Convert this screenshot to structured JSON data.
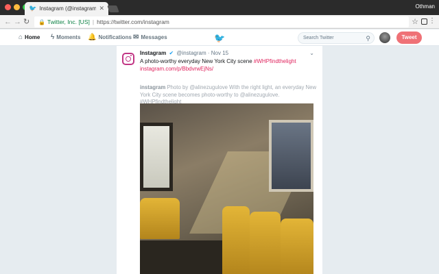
{
  "browser": {
    "tab_title": "Instagram (@instagram) | Twi",
    "profile_name": "Othman",
    "security_label": "Twitter, Inc. [US]",
    "url": "https://twitter.com/instagram"
  },
  "nav": {
    "home": "Home",
    "moments": "Moments",
    "notifications": "Notifications",
    "messages": "Messages",
    "search_placeholder": "Search Twitter",
    "tweet_button": "Tweet"
  },
  "tweet": {
    "author": "Instagram",
    "handle": "@instagram",
    "date": "· Nov 15",
    "text": "A photo-worthy everyday New York City scene",
    "hashtag": "#WHPfindthelight",
    "link": "instagram.com/p/BbdvrwEjNs/",
    "quote_author": "instagram",
    "quote_text": "Photo by @alinezugulove With the right light, an everyday New York City scene becomes photo-worthy to @alinezugulove. #WHPfindthelight"
  },
  "colors": {
    "twitter_blue": "#1da1f2",
    "tweet_button": "#ef7176",
    "hashtag": "#e0245e"
  }
}
